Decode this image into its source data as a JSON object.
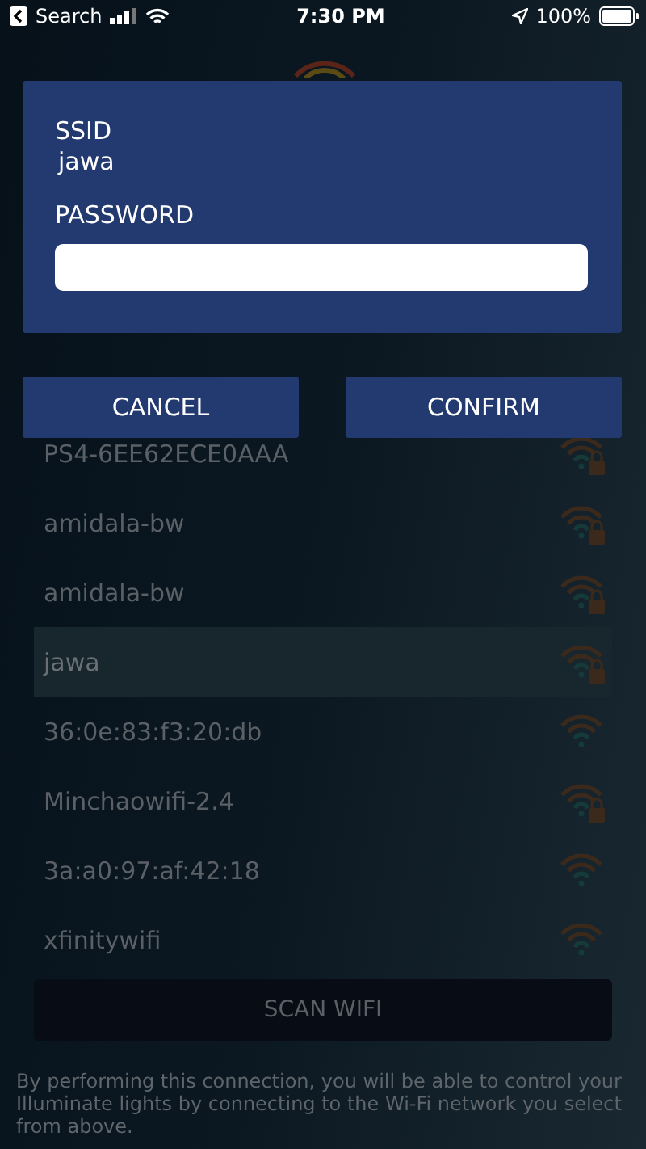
{
  "status_bar": {
    "back_label": "Search",
    "time": "7:30 PM",
    "battery": "100%"
  },
  "networks": [
    {
      "name": "PS4-6EE62ECE0AAA",
      "locked": true,
      "selected": false
    },
    {
      "name": "amidala-bw",
      "locked": true,
      "selected": false
    },
    {
      "name": "amidala-bw",
      "locked": true,
      "selected": false
    },
    {
      "name": "jawa",
      "locked": true,
      "selected": true
    },
    {
      "name": "36:0e:83:f3:20:db",
      "locked": false,
      "selected": false
    },
    {
      "name": "Minchaowifi-2.4",
      "locked": true,
      "selected": false
    },
    {
      "name": "3a:a0:97:af:42:18",
      "locked": false,
      "selected": false
    },
    {
      "name": "xfinitywifi",
      "locked": false,
      "selected": false
    }
  ],
  "scan_button": "SCAN WIFI",
  "footer": "By performing this connection, you will be able to control your Illuminate lights by connecting to the Wi-Fi network you select from above.",
  "dialog": {
    "ssid_label": "SSID",
    "ssid": "jawa",
    "password_label": "PASSWORD",
    "buttons": [
      "CANCEL",
      "CONFIRM"
    ]
  }
}
